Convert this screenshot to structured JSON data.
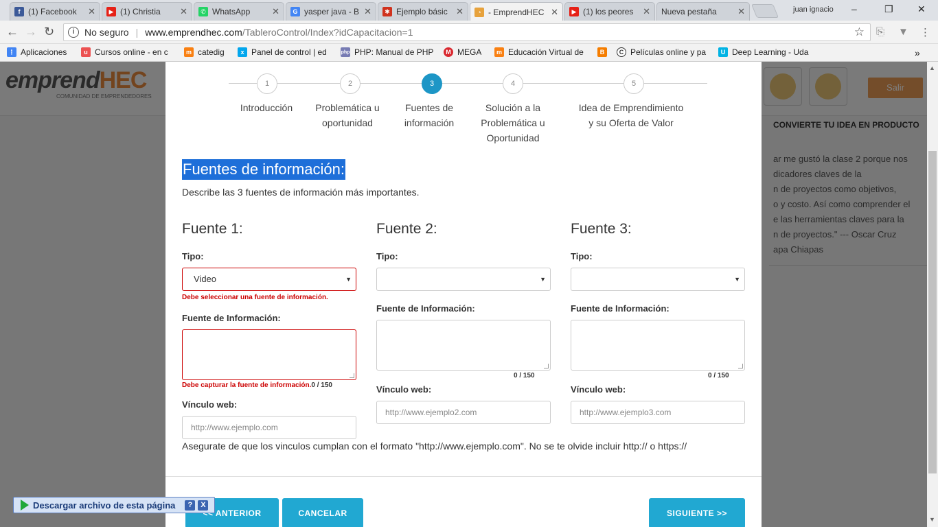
{
  "browser": {
    "tabs": [
      {
        "title": "(1) Facebook",
        "icon": "facebook-icon",
        "color": "#3b5998",
        "glyph": "f"
      },
      {
        "title": "(1) Christia",
        "icon": "youtube-icon",
        "color": "#e62117",
        "glyph": "▶"
      },
      {
        "title": "WhatsApp",
        "icon": "whatsapp-icon",
        "color": "#25d366",
        "glyph": "✆"
      },
      {
        "title": "yasper java - B",
        "icon": "google-icon",
        "color": "#4285f4",
        "glyph": "G"
      },
      {
        "title": "Ejemplo básic",
        "icon": "site-icon",
        "color": "#d0321e",
        "glyph": "✱"
      },
      {
        "title": "- EmprendHEC",
        "icon": "loading-icon",
        "color": "#e7a23c",
        "glyph": "◔"
      },
      {
        "title": "(1) los peores",
        "icon": "youtube-icon",
        "color": "#e62117",
        "glyph": "▶"
      },
      {
        "title": "Nueva pestaña",
        "icon": "newtab-icon",
        "color": "#cfd3d9",
        "glyph": ""
      }
    ],
    "user_name": "juan ignacio",
    "security_label": "No seguro",
    "url_host": "www.emprendhec.com",
    "url_path": "/TableroControl/Index?idCapacitacion=1",
    "bookmarks": [
      {
        "label": "Aplicaciones",
        "icon": "apps-icon",
        "color": "#4285f4",
        "glyph": "⋮"
      },
      {
        "label": "Cursos online - en c",
        "icon": "udemy-icon",
        "color": "#ec5252",
        "glyph": "u"
      },
      {
        "label": "catedig",
        "icon": "moodle-icon",
        "color": "#f98012",
        "glyph": "m"
      },
      {
        "label": "Panel de control | ed",
        "icon": "edx-icon",
        "color": "#02a6ed",
        "glyph": "x"
      },
      {
        "label": "PHP: Manual de PHP",
        "icon": "php-icon",
        "color": "#777bb3",
        "glyph": "php"
      },
      {
        "label": "MEGA",
        "icon": "mega-icon",
        "color": "#d9272e",
        "glyph": "M"
      },
      {
        "label": "Educación Virtual de",
        "icon": "moodle-icon",
        "color": "#f98012",
        "glyph": "m"
      },
      {
        "label": "Películas online y pa",
        "icon": "blogger-icon",
        "color": "#f57d00",
        "glyph": "B"
      },
      {
        "label": "Deep Learning - Uda",
        "icon": "udacity-icon",
        "color": "#02b3e4",
        "glyph": "U"
      }
    ]
  },
  "site": {
    "logo_main": "emprend",
    "logo_accent": "HEC",
    "logo_sub": "COMUNIDAD DE EMPRENDEDORES",
    "salir_label": "Salir",
    "right_panel_title": "CONVIERTE TU IDEA EN PRODUCTO",
    "right_panel_quote": [
      "ar me gustó la clase 2 porque nos",
      "dicadores claves de la",
      "n de proyectos como objetivos,",
      "o y costo. Así como comprender el",
      "e las herramientas claves para la",
      "n de proyectos.\" --- Oscar Cruz",
      "apa Chiapas"
    ]
  },
  "stepper": {
    "steps": [
      {
        "number": "1",
        "label_lines": [
          "Introducción"
        ]
      },
      {
        "number": "2",
        "label_lines": [
          "Problemática u",
          "oportunidad"
        ]
      },
      {
        "number": "3",
        "label_lines": [
          "Fuentes de",
          "información"
        ]
      },
      {
        "number": "4",
        "label_lines": [
          "Solución a la",
          "Problemática u",
          "Oportunidad"
        ]
      },
      {
        "number": "5",
        "label_lines": [
          "Idea de Emprendimiento",
          "y su Oferta de Valor"
        ]
      }
    ],
    "active_step": 3
  },
  "form": {
    "title": "Fuentes de información:",
    "description": "Describe las 3 fuentes de información más importantes.",
    "type_label": "Tipo:",
    "source_label": "Fuente de Información:",
    "link_label": "Vínculo web:",
    "sources": [
      {
        "heading": "Fuente 1:",
        "type_value": "Video",
        "type_error": "Debe seleccionar una fuente de información.",
        "source_error": "Debe capturar la fuente de información.",
        "counter": "0 / 150",
        "link_placeholder": "http://www.ejemplo.com"
      },
      {
        "heading": "Fuente 2:",
        "type_value": "",
        "type_error": "",
        "source_error": "",
        "counter": "0 / 150",
        "link_placeholder": "http://www.ejemplo2.com"
      },
      {
        "heading": "Fuente 3:",
        "type_value": "",
        "type_error": "",
        "source_error": "",
        "counter": "0 / 150",
        "link_placeholder": "http://www.ejemplo3.com"
      }
    ],
    "note": "Asegurate de que los vinculos cumplan con el formato \"http://www.ejemplo.com\". No se te olvide incluir http:// o https://"
  },
  "buttons": {
    "prev": "<< ANTERIOR",
    "cancel": "CANCELAR",
    "next": "SIGUIENTE >>"
  },
  "download_bar": {
    "label": "Descargar archivo de esta página",
    "help": "?",
    "close": "X"
  }
}
